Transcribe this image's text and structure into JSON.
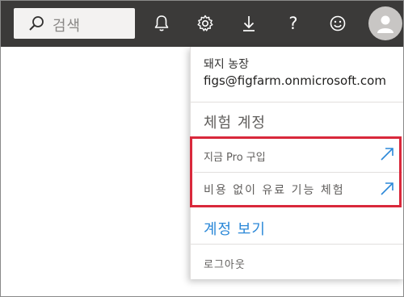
{
  "topbar": {
    "background": "#3b3a39",
    "search": {
      "placeholder": "검색",
      "icon": "search-icon"
    },
    "icons": [
      "bell-icon",
      "gear-icon",
      "download-icon",
      "help-icon",
      "smiley-icon",
      "avatar-icon"
    ],
    "help_glyph": "?"
  },
  "account_panel": {
    "org_name": "돼지 농장",
    "email": "figs@figfarm.onmicrosoft.com",
    "trial_header": "체험 계정",
    "links": [
      {
        "label": "지금 Pro 구입",
        "icon": "external-link-icon"
      },
      {
        "label": "비용 없이 유료 기능 체험",
        "icon": "external-link-icon"
      }
    ],
    "view_account": "계정 보기",
    "logout": "로그아웃",
    "highlight_color": "#d9283b",
    "link_color": "#2b88d8"
  }
}
